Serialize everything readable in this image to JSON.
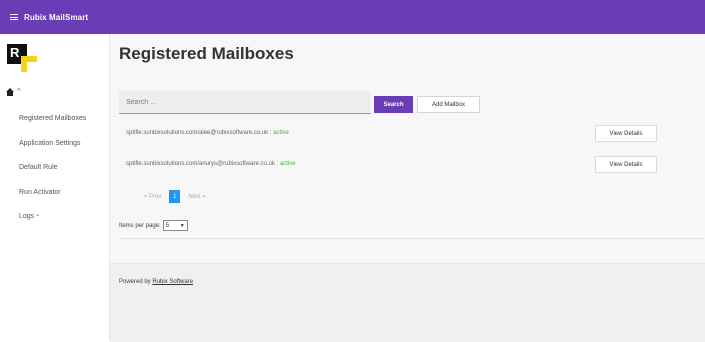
{
  "app": {
    "title": "Rubix MailSmart"
  },
  "logo": {
    "letter": "R"
  },
  "sidebar": {
    "items": [
      {
        "label": "Registered Mailboxes"
      },
      {
        "label": "Application Settings"
      },
      {
        "label": "Default Rule"
      },
      {
        "label": "Run Activator"
      },
      {
        "label": "Logs"
      }
    ]
  },
  "main": {
    "title": "Registered Mailboxes",
    "search": {
      "placeholder": "Search ...",
      "value": ""
    },
    "search_button": "Search",
    "add_mailbox_button": "Add Mailbox",
    "mailboxes": [
      {
        "path": "sptifle.sunbixsolutions.com/alee@rubixsoftware.co.uk",
        "separator": " : ",
        "status": "active",
        "button": "View Details"
      },
      {
        "path": "sptifle.sunbixsolutions.com/anurys@rubixsoftware.co.uk",
        "separator": " : ",
        "status": "active",
        "button": "View Details"
      }
    ],
    "pagination": {
      "prev": "« Prev",
      "current": "1",
      "next": "Next »"
    },
    "items_per_page": {
      "label": "Items per page:",
      "value": "5"
    },
    "footer": {
      "prefix": "Powered by ",
      "link": "Rubix Software"
    }
  },
  "colors": {
    "brand": "#6a3cb5",
    "active_status": "#4caf50",
    "page_current": "#2196f3",
    "logo_yellow": "#f5d316"
  },
  "icons": [
    "menu-icon",
    "home-icon",
    "caret-up-icon",
    "chevron-down-icon"
  ]
}
